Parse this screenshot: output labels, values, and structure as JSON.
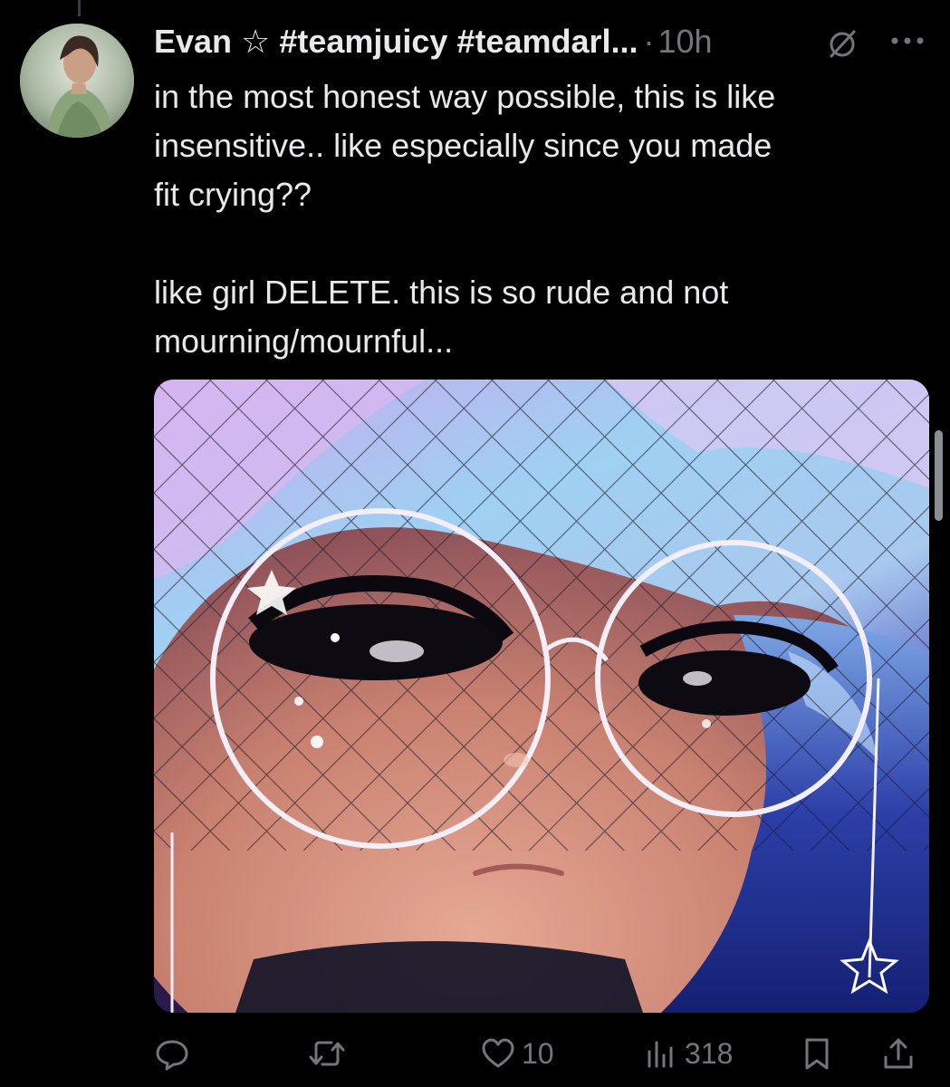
{
  "tweet": {
    "display_name": "Evan ☆ #teamjuicy #teamdarl...",
    "separator": "·",
    "time": "10h",
    "text_lines": [
      "in the most honest way possible, this is like",
      "insensitive.. like especially since you made",
      "fit crying??",
      "like girl DELETE. this is so rude and not",
      "mourning/mournful..."
    ]
  },
  "actions": {
    "likes": "10",
    "views": "318"
  },
  "icons": {
    "reply": "reply-icon",
    "retweet": "retweet-icon",
    "like": "heart-icon",
    "views": "views-icon",
    "bookmark": "bookmark-icon",
    "share": "share-icon",
    "noreply": "no-reply-icon",
    "more": "more-icon"
  },
  "colors": {
    "background": "#000000",
    "text": "#e7e9ea",
    "muted": "#71767b"
  }
}
